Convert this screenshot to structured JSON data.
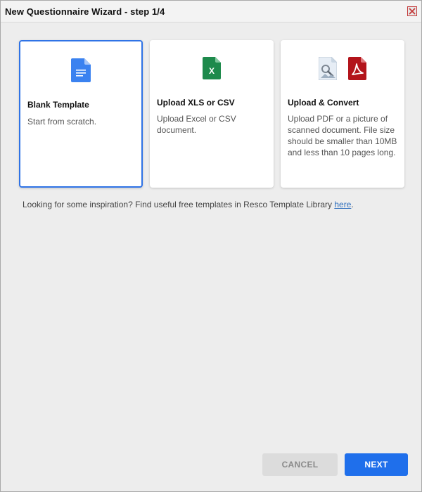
{
  "window": {
    "title": "New Questionnaire Wizard - step 1/4"
  },
  "cards": [
    {
      "title": "Blank Template",
      "description": "Start from scratch.",
      "icon": "google-doc-icon",
      "selected": true
    },
    {
      "title": "Upload XLS or CSV",
      "description_lines": [
        "Upload Excel or CSV",
        "document."
      ],
      "icon": "excel-file-icon",
      "selected": false
    },
    {
      "title": "Upload & Convert",
      "description_lines": [
        "Upload PDF or a picture of",
        "scanned document. File size",
        "should be smaller than 10MB",
        "and less than 10 pages long."
      ],
      "icons": [
        "image-file-icon",
        "pdf-file-icon"
      ],
      "selected": false
    }
  ],
  "hint": {
    "text": "Looking for some inspiration? Find useful free templates in Resco Template Library ",
    "link": "here",
    "suffix": "."
  },
  "footer": {
    "cancel_label": "CANCEL",
    "next_label": "NEXT"
  },
  "colors": {
    "accent": "#1f6feb",
    "selected_border": "#2f73e6",
    "link": "#2f6fbd"
  }
}
